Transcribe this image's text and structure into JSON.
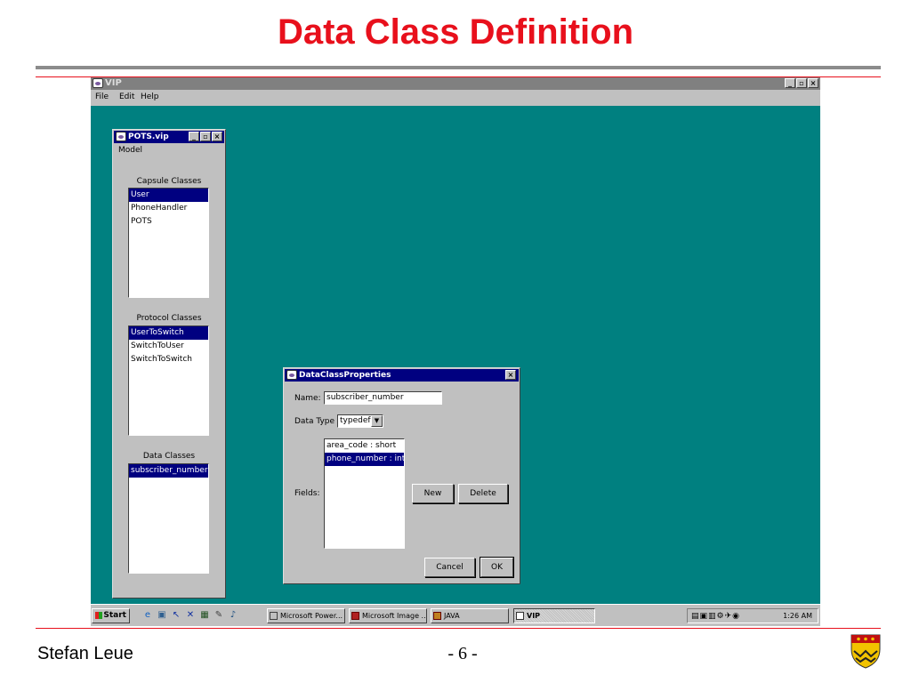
{
  "slide": {
    "title": "Data Class Definition",
    "author": "Stefan Leue",
    "page_number": "- 6 -"
  },
  "app": {
    "title": "VIP",
    "menu": [
      "File",
      "Edit",
      "Help"
    ],
    "controls": {
      "minimize": "_",
      "maximize": "▫",
      "close": "×"
    }
  },
  "pots_window": {
    "title": "POTS.vip",
    "menu": "Model",
    "capsule_label": "Capsule Classes",
    "capsule_classes": [
      "User",
      "PhoneHandler",
      "POTS"
    ],
    "protocol_label": "Protocol Classes",
    "protocol_classes": [
      "UserToSwitch",
      "SwitchToUser",
      "SwitchToSwitch"
    ],
    "data_label": "Data Classes",
    "data_classes": [
      "subscriber_number"
    ]
  },
  "dialog": {
    "title": "DataClassProperties",
    "name_label": "Name:",
    "name_value": "subscriber_number",
    "datatype_label": "Data Type",
    "datatype_value": "typedef",
    "fields_label": "Fields:",
    "fields": [
      "area_code : short",
      "phone_number : int"
    ],
    "new_label": "New",
    "delete_label": "Delete",
    "cancel_label": "Cancel",
    "ok_label": "OK"
  },
  "taskbar": {
    "start_label": "Start",
    "tasks": [
      "Microsoft Power...",
      "Microsoft Image ...",
      "JAVA",
      "VIP"
    ],
    "clock": "1:26 AM"
  },
  "colors": {
    "title_red": "#e8101c",
    "desktop_teal": "#008080",
    "selection_navy": "#000080"
  }
}
